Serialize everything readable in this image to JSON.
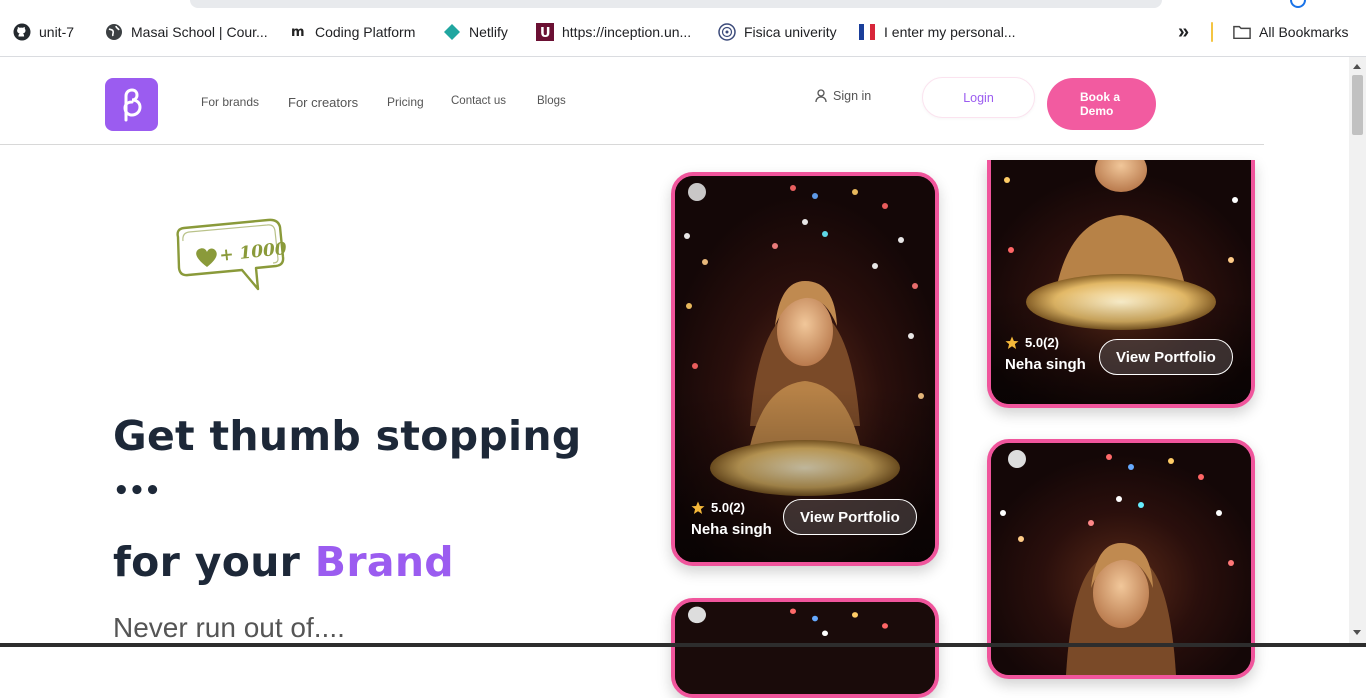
{
  "bookmarks": [
    {
      "label": "unit-7",
      "icon": "github-icon"
    },
    {
      "label": "Masai School | Cour...",
      "icon": "globe-icon"
    },
    {
      "label": "Coding Platform",
      "icon": "masai-m-icon"
    },
    {
      "label": "Netlify",
      "icon": "netlify-icon"
    },
    {
      "label": "https://inception.un...",
      "icon": "u-icon"
    },
    {
      "label": "Fisica univerity",
      "icon": "emblem-icon"
    },
    {
      "label": "I enter my personal...",
      "icon": "flag-icon"
    }
  ],
  "bookmarks_more": "»",
  "all_bookmarks": "All Bookmarks",
  "nav": {
    "links": [
      "For brands",
      "For creators",
      "Pricing",
      "Contact us",
      "Blogs"
    ],
    "signin": "Sign in",
    "login": "Login",
    "demo_line1": "Book a",
    "demo_line2": "Demo"
  },
  "hero": {
    "badge_text": "+ 1000",
    "line1": "Get thumb stopping",
    "line2": "•••",
    "line3_prefix": "for your ",
    "line3_brand": "Brand",
    "subtitle": "Never run out of...."
  },
  "cards": [
    {
      "rating": "5.0(2)",
      "name": "Neha singh",
      "button": "View Portfolio"
    },
    {
      "rating": "5.0(2)",
      "name": "Neha singh",
      "button": "View Portfolio"
    }
  ],
  "colors": {
    "brand_purple": "#9b5cf0",
    "brand_pink": "#f25ba0",
    "card_border": "#f0559c",
    "heading": "#1d2838",
    "badge_olive": "#8a9a3a"
  }
}
